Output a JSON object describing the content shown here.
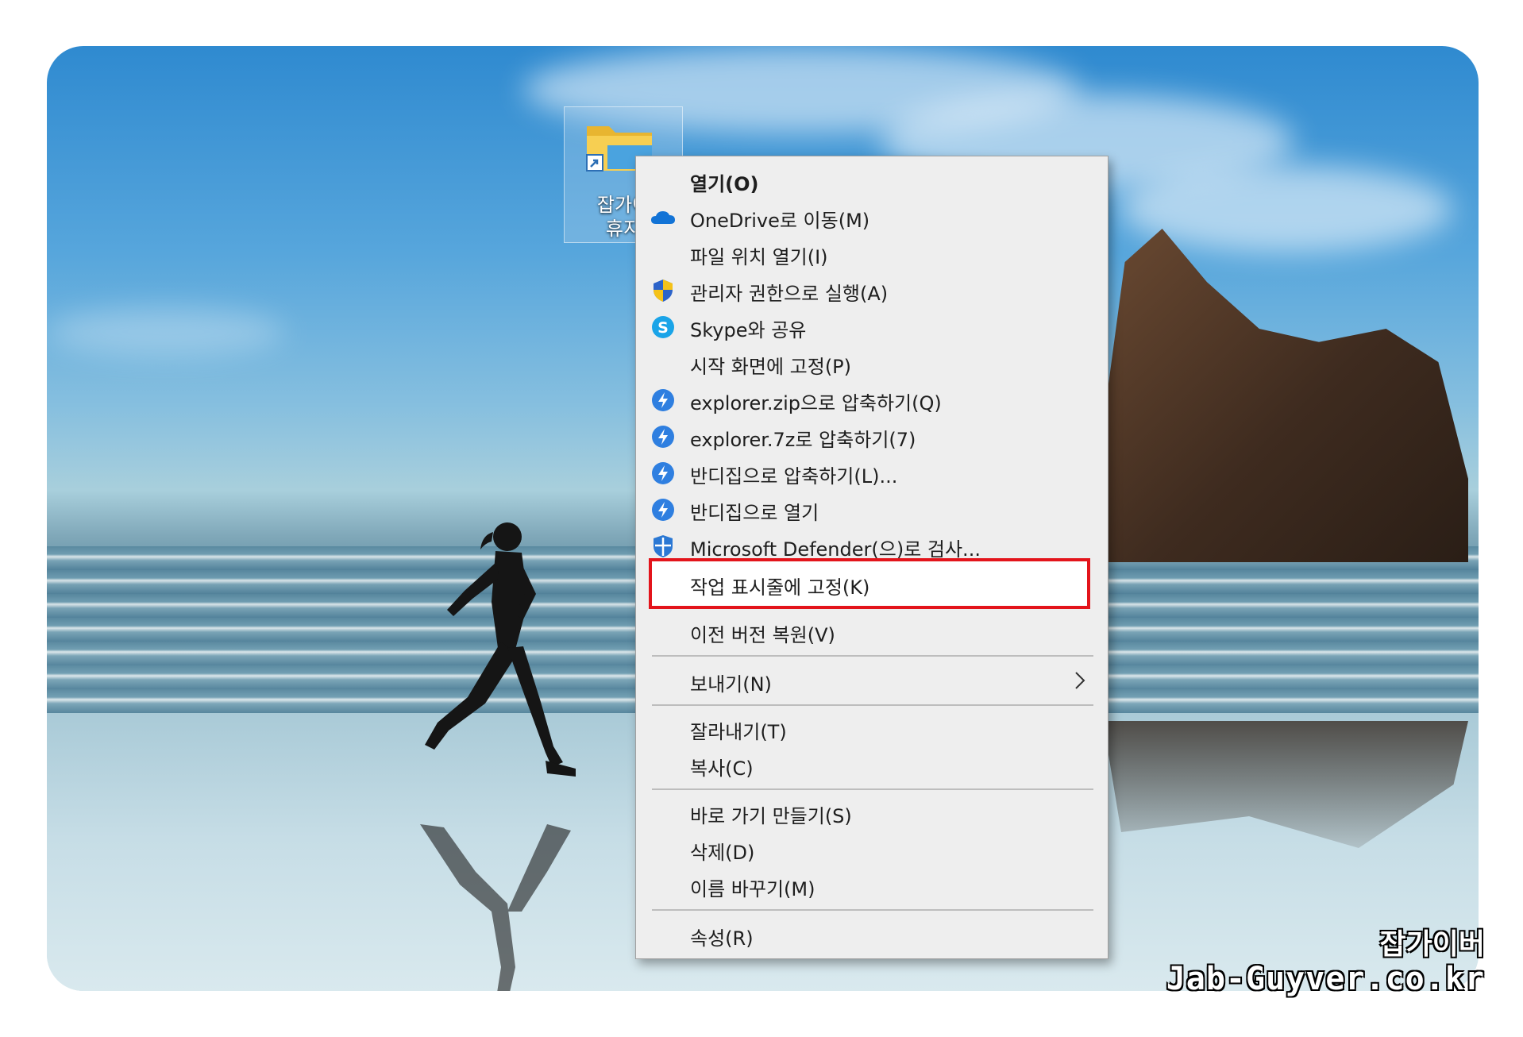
{
  "desktop": {
    "icon_label": "잡가이\n휴지"
  },
  "menu": {
    "items": [
      {
        "label": "열기(O)",
        "icon": "none",
        "bold": true
      },
      {
        "label": "OneDrive로 이동(M)",
        "icon": "onedrive-cloud-icon"
      },
      {
        "label": "파일 위치 열기(I)",
        "icon": "none"
      },
      {
        "label": "관리자 권한으로 실행(A)",
        "icon": "uac-shield-icon"
      },
      {
        "label": "Skype와 공유",
        "icon": "skype-icon"
      },
      {
        "label": "시작 화면에 고정(P)",
        "icon": "none"
      },
      {
        "label": "explorer.zip으로 압축하기(Q)",
        "icon": "bandizip-icon"
      },
      {
        "label": "explorer.7z로 압축하기(7)",
        "icon": "bandizip-icon"
      },
      {
        "label": "반디집으로 압축하기(L)...",
        "icon": "bandizip-icon"
      },
      {
        "label": "반디집으로 열기",
        "icon": "bandizip-icon"
      },
      {
        "label": "Microsoft Defender(으)로 검사...",
        "icon": "defender-icon"
      },
      {
        "label": "작업 표시줄에 고정(K)",
        "icon": "none",
        "highlighted": true
      },
      {
        "label": "이전 버전 복원(V)",
        "icon": "none"
      },
      {
        "label": "보내기(N)",
        "icon": "none",
        "submenu": true
      },
      {
        "label": "잘라내기(T)",
        "icon": "none"
      },
      {
        "label": "복사(C)",
        "icon": "none"
      },
      {
        "label": "바로 가기 만들기(S)",
        "icon": "none"
      },
      {
        "label": "삭제(D)",
        "icon": "none"
      },
      {
        "label": "이름 바꾸기(M)",
        "icon": "none"
      },
      {
        "label": "속성(R)",
        "icon": "none"
      }
    ],
    "highlight_color": "#e3141b"
  },
  "watermark": {
    "line1": "잡가이버",
    "line2": "Jab-Guyver.co.kr"
  }
}
